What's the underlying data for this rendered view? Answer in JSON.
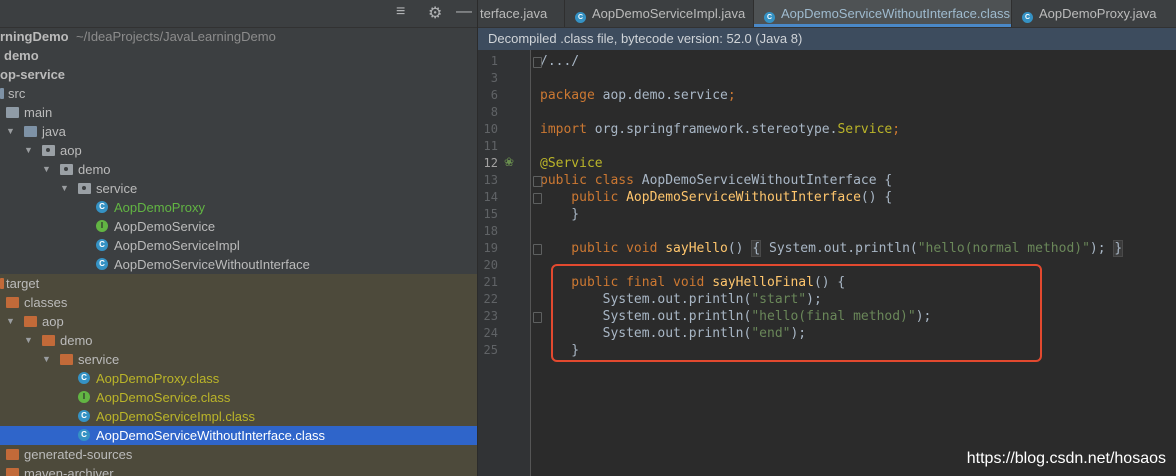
{
  "toolbar": {
    "icons": [
      "collapse-icon",
      "gear-icon",
      "minimize-icon"
    ]
  },
  "tabs": [
    {
      "label": "terface.java",
      "active": false,
      "color": "#bbbbbb"
    },
    {
      "label": "AopDemoServiceImpl.java",
      "active": false,
      "color": "#bbbbbb"
    },
    {
      "label": "AopDemoServiceWithoutInterface.class",
      "active": true,
      "color": "#9fbbcf"
    },
    {
      "label": "AopDemoProxy.java",
      "active": false,
      "color": "#bbbbbb"
    }
  ],
  "banner": "Decompiled .class file, bytecode version: 52.0 (Java 8)",
  "tree": [
    {
      "label": "rningDemo",
      "suffix": "~/IdeaProjects/JavaLearningDemo",
      "bold": true
    },
    {
      "label": "demo",
      "bold": true
    },
    {
      "label": "op-service",
      "bold": true
    },
    {
      "label": "src"
    },
    {
      "label": "main"
    },
    {
      "label": "java"
    },
    {
      "label": "aop"
    },
    {
      "label": "demo"
    },
    {
      "label": "service"
    },
    {
      "label": "AopDemoProxy"
    },
    {
      "label": "AopDemoService"
    },
    {
      "label": "AopDemoServiceImpl"
    },
    {
      "label": "AopDemoServiceWithoutInterface"
    },
    {
      "label": "target"
    },
    {
      "label": "classes"
    },
    {
      "label": "aop"
    },
    {
      "label": "demo"
    },
    {
      "label": "service"
    },
    {
      "label": "AopDemoProxy.class"
    },
    {
      "label": "AopDemoService.class"
    },
    {
      "label": "AopDemoServiceImpl.class"
    },
    {
      "label": "AopDemoServiceWithoutInterface.class"
    },
    {
      "label": "generated-sources"
    },
    {
      "label": "maven-archiver"
    }
  ],
  "line_numbers": [
    "1",
    "3",
    "6",
    "8",
    "10",
    "11",
    "12",
    "13",
    "14",
    "15",
    "18",
    "19",
    "20",
    "21",
    "22",
    "23",
    "24",
    "25"
  ],
  "code": [
    {
      "n": "1",
      "tokens": [
        [
          "/.../",
          "cls"
        ]
      ]
    },
    {
      "n": "3",
      "tokens": []
    },
    {
      "n": "6",
      "tokens": [
        [
          "package ",
          "kw"
        ],
        [
          "aop.demo.service",
          "cls"
        ],
        [
          ";",
          "kw"
        ]
      ]
    },
    {
      "n": "8",
      "tokens": []
    },
    {
      "n": "10",
      "tokens": [
        [
          "import ",
          "kw"
        ],
        [
          "org.springframework.stereotype.",
          "cls"
        ],
        [
          "Service",
          "svc"
        ],
        [
          ";",
          "kw"
        ]
      ]
    },
    {
      "n": "11",
      "tokens": []
    },
    {
      "n": "12",
      "tokens": [
        [
          "@Service",
          "ann"
        ]
      ]
    },
    {
      "n": "13",
      "tokens": [
        [
          "public class ",
          "kw"
        ],
        [
          "AopDemoServiceWithoutInterface {",
          "cls"
        ]
      ]
    },
    {
      "n": "14",
      "tokens": [
        [
          "    public ",
          "kw"
        ],
        [
          "AopDemoServiceWithoutInterface",
          "fn"
        ],
        [
          "() {",
          "cls"
        ]
      ]
    },
    {
      "n": "15",
      "tokens": [
        [
          "    }",
          "cls"
        ]
      ]
    },
    {
      "n": "18",
      "tokens": []
    },
    {
      "n": "19",
      "tokens": [
        [
          "    public void ",
          "kw"
        ],
        [
          "sayHello",
          "fn"
        ],
        [
          "() ",
          "cls"
        ],
        [
          "{",
          "ph"
        ],
        [
          " System.",
          "cls"
        ],
        [
          "out",
          "cls"
        ],
        [
          ".println(",
          "cls"
        ],
        [
          "\"hello(normal method)\"",
          "str"
        ],
        [
          ");",
          "cls"
        ],
        [
          " ",
          "cls"
        ],
        [
          "}",
          "ph"
        ]
      ]
    },
    {
      "n": "20",
      "tokens": []
    },
    {
      "n": "21",
      "tokens": [
        [
          "    public final void ",
          "kw"
        ],
        [
          "sayHelloFinal",
          "fn"
        ],
        [
          "() {",
          "cls"
        ]
      ]
    },
    {
      "n": "22",
      "tokens": [
        [
          "        System.",
          "cls"
        ],
        [
          "out",
          "cls"
        ],
        [
          ".println(",
          "cls"
        ],
        [
          "\"start\"",
          "str"
        ],
        [
          ");",
          "cls"
        ]
      ]
    },
    {
      "n": "23",
      "tokens": [
        [
          "        System.",
          "cls"
        ],
        [
          "out",
          "cls"
        ],
        [
          ".println(",
          "cls"
        ],
        [
          "\"hello(final method)\"",
          "str"
        ],
        [
          ");",
          "cls"
        ]
      ]
    },
    {
      "n": "24",
      "tokens": [
        [
          "        System.",
          "cls"
        ],
        [
          "out",
          "cls"
        ],
        [
          ".println(",
          "cls"
        ],
        [
          "\"end\"",
          "str"
        ],
        [
          ");",
          "cls"
        ]
      ]
    },
    {
      "n": "25",
      "tokens": [
        [
          "    }",
          "cls"
        ]
      ]
    }
  ],
  "watermark": "https://blog.csdn.net/hosaos"
}
